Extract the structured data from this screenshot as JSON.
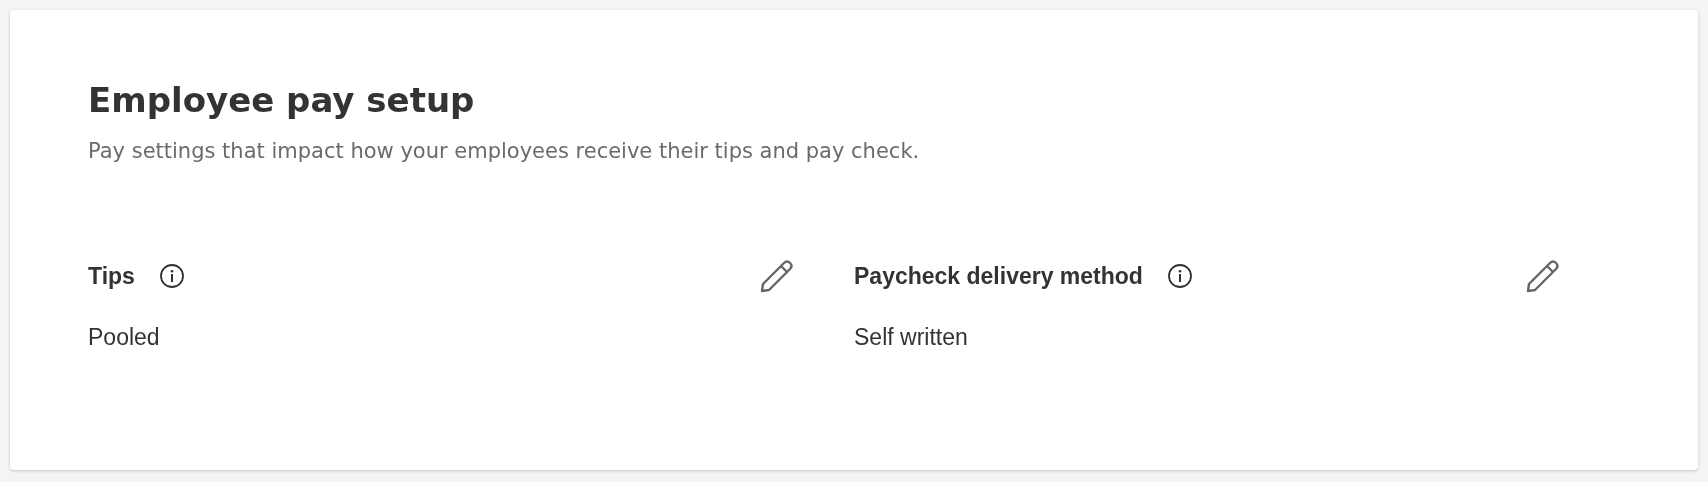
{
  "card": {
    "title": "Employee pay setup",
    "description": "Pay settings that impact how your employees receive their tips and pay check.",
    "settings": [
      {
        "label": "Tips",
        "value": "Pooled"
      },
      {
        "label": "Paycheck delivery method",
        "value": "Self written"
      }
    ]
  }
}
